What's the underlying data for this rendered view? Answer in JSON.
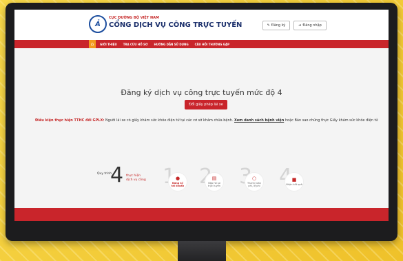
{
  "header": {
    "org_small": "CỤC ĐƯỜNG BỘ VIỆT NAM",
    "org_big": "CỔNG DỊCH VỤ CÔNG TRỰC TUYẾN",
    "register_label": "Đăng ký",
    "login_label": "Đăng nhập"
  },
  "nav": {
    "items": [
      "GIỚI THIỆU",
      "TRA CỨU HỒ SƠ",
      "HƯỚNG DẪN SỬ DỤNG",
      "CÂU HỎI THƯỜNG GẶP"
    ]
  },
  "main": {
    "title": "Đăng ký dịch vụ công trực tuyến mức độ 4",
    "cta_label": "Đổi giấy phép lái xe",
    "condition_prefix": "Điều kiện thực hiện TTHC đổi GPLX:",
    "condition_text": " Người lái xe có giấy khám sức khỏe điện tử tại các cơ sở khám chữa bệnh",
    "condition_link": "Xem danh sách bệnh viện",
    "condition_suffix": " hoặc Bản sao chứng thực Giấy khám sức khỏe điện tử"
  },
  "process": {
    "label": "Quy trình",
    "count": "4",
    "desc_line1": "thực hiện",
    "desc_line2": "dịch vụ công",
    "steps": [
      {
        "num": "1",
        "line1": "Đăng ký",
        "line2": "tài khoản",
        "icon": "user-icon"
      },
      {
        "num": "2",
        "line1": "Nộp hồ sơ",
        "line2": "trực tuyến",
        "icon": "document-icon"
      },
      {
        "num": "3",
        "line1": "Thanh toán",
        "line2": "phí, lệ phí",
        "icon": "payment-icon"
      },
      {
        "num": "4",
        "line1": "Nhận kết quả",
        "line2": "",
        "icon": "result-icon"
      }
    ]
  }
}
